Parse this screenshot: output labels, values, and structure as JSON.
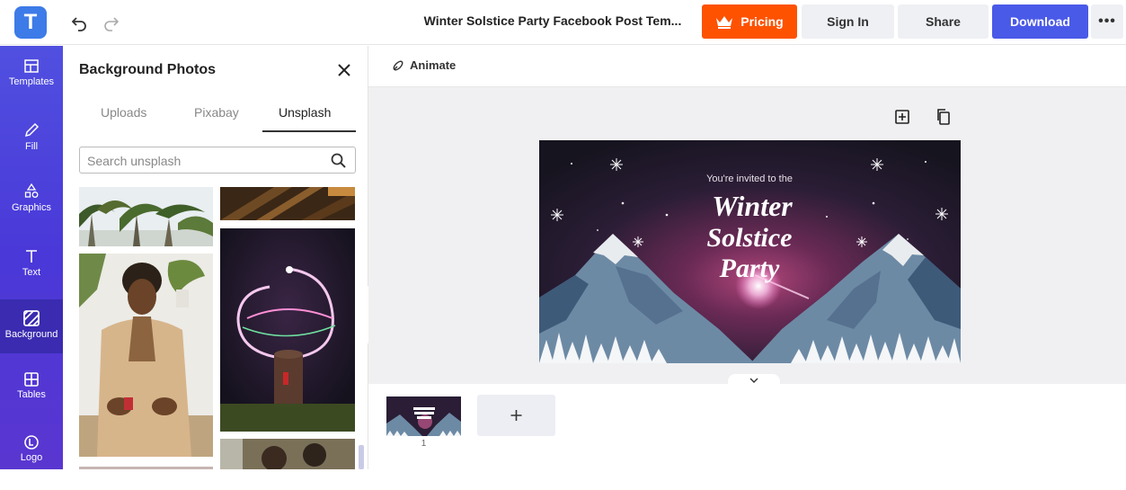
{
  "app": {
    "logo_letter": "T",
    "document_title": "Winter Solstice Party Facebook Post Tem..."
  },
  "topbar": {
    "pricing_label": "Pricing",
    "signin_label": "Sign In",
    "share_label": "Share",
    "download_label": "Download",
    "more_label": "•••"
  },
  "sidebar": {
    "items": [
      {
        "label": "Templates",
        "icon": "templates-icon"
      },
      {
        "label": "Fill",
        "icon": "pencil-icon"
      },
      {
        "label": "Graphics",
        "icon": "shapes-icon"
      },
      {
        "label": "Text",
        "icon": "text-icon"
      },
      {
        "label": "Background",
        "icon": "background-icon",
        "active": true
      },
      {
        "label": "Tables",
        "icon": "table-icon"
      },
      {
        "label": "Logo",
        "icon": "logo-icon"
      }
    ]
  },
  "panel": {
    "title": "Background Photos",
    "tabs": [
      "Uploads",
      "Pixabay",
      "Unsplash"
    ],
    "active_tab": "Unsplash",
    "search_placeholder": "Search unsplash"
  },
  "canvas": {
    "animate_label": "Animate",
    "poster": {
      "line1": "You're invited to the",
      "line2": "Winter",
      "line3": "Solstice",
      "line4": "Party"
    },
    "page_number": "1"
  },
  "colors": {
    "brand_blue": "#3d7be8",
    "pricing_orange": "#fe5200",
    "download_blue": "#4a5ae8",
    "sidebar_purple": "#4a38d8"
  }
}
